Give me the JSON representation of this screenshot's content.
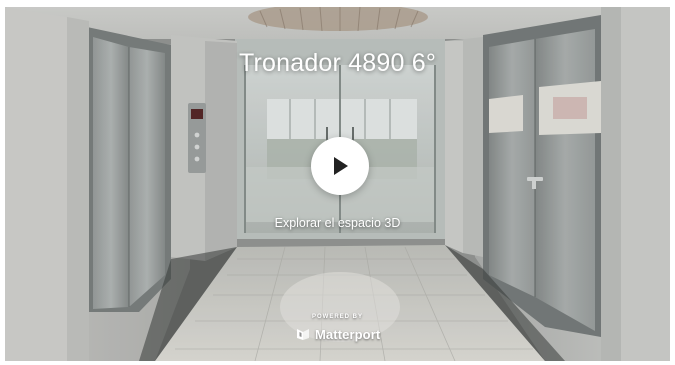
{
  "tour": {
    "title": "Tronador 4890 6°",
    "explore_label": "Explorar el espacio 3D",
    "play_icon": "play-icon"
  },
  "branding": {
    "powered_by": "POWERED BY",
    "name": "Matterport",
    "icon": "matterport-logo-icon"
  },
  "colors": {
    "text": "#ffffff",
    "play_button_bg": "#ffffff",
    "play_glyph": "#222222"
  }
}
